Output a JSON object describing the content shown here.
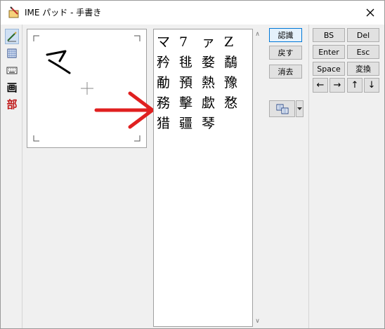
{
  "window": {
    "title": "IME パッド - 手書き"
  },
  "toolbar": {
    "handwriting_label": "手書き",
    "char_list_label": "文字一覧",
    "soft_keyboard_label": "ソフトキーボード",
    "stroke_char": "画",
    "radical_char": "部"
  },
  "candidates": [
    [
      "マ",
      "7",
      "ァ",
      "Z"
    ],
    [
      "矜",
      "毴",
      "婺",
      "鷸"
    ],
    [
      "勈",
      "預",
      "熱",
      "豫"
    ],
    [
      "務",
      "擊",
      "歔",
      "愗"
    ],
    [
      "猎",
      "疆",
      "琴"
    ]
  ],
  "buttons": {
    "recognize": "認識",
    "back": "戻す",
    "erase": "消去",
    "bs": "BS",
    "del": "Del",
    "enter": "Enter",
    "esc": "Esc",
    "space": "Space",
    "convert": "変換",
    "left": "←",
    "right": "→",
    "up": "↑",
    "down": "↓"
  },
  "colors": {
    "annotation_arrow": "#e02020",
    "focus_border": "#0078d7"
  },
  "icons": [
    "ime-pad-icon",
    "close-icon",
    "pen-icon",
    "char-list-icon",
    "keyboard-icon",
    "transfer-icon",
    "dropdown-icon"
  ]
}
